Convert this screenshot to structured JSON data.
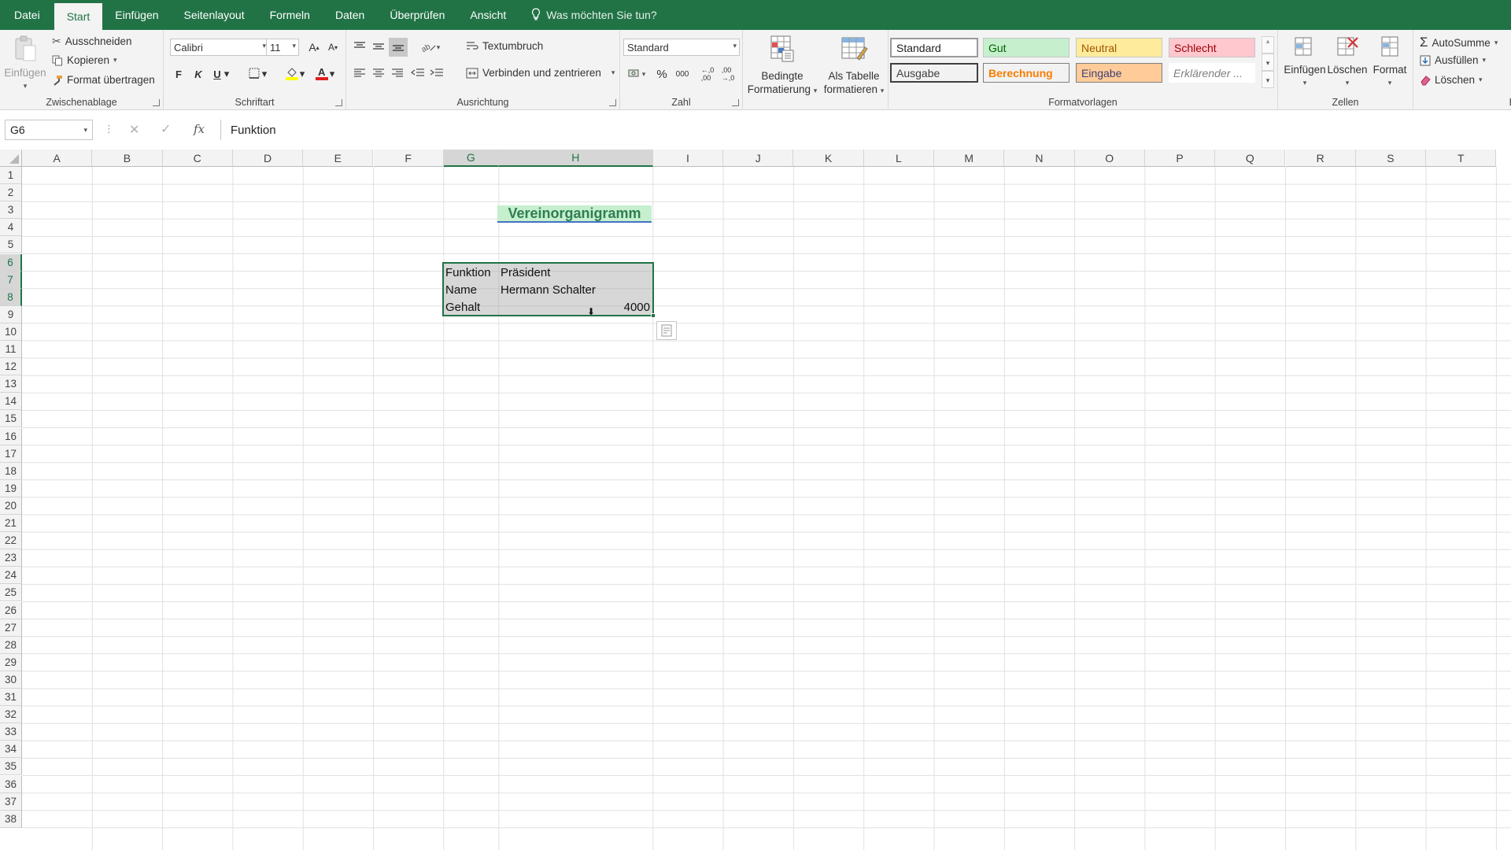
{
  "tabs": [
    {
      "label": "Datei",
      "active": false
    },
    {
      "label": "Start",
      "active": true
    },
    {
      "label": "Einfügen",
      "active": false
    },
    {
      "label": "Seitenlayout",
      "active": false
    },
    {
      "label": "Formeln",
      "active": false
    },
    {
      "label": "Daten",
      "active": false
    },
    {
      "label": "Überprüfen",
      "active": false
    },
    {
      "label": "Ansicht",
      "active": false
    }
  ],
  "tellme": {
    "label": "Was möchten Sie tun?",
    "icon": "lightbulb-icon"
  },
  "clipboard": {
    "group_label": "Zwischenablage",
    "paste_label": "Einfügen",
    "cut_label": "Ausschneiden",
    "copy_label": "Kopieren",
    "format_painter_label": "Format übertragen"
  },
  "font": {
    "group_label": "Schriftart",
    "family": "Calibri",
    "size": "11",
    "bold": "F",
    "italic": "K",
    "underline": "U"
  },
  "alignment": {
    "group_label": "Ausrichtung",
    "wrap_label": "Textumbruch",
    "merge_label": "Verbinden und zentrieren"
  },
  "number": {
    "group_label": "Zahl",
    "format": "Standard",
    "percent": "%",
    "thousands": "000"
  },
  "conditional": {
    "line1": "Bedingte",
    "line2": "Formatierung"
  },
  "as_table": {
    "line1": "Als Tabelle",
    "line2": "formatieren"
  },
  "styles": {
    "group_label": "Formatvorlagen",
    "items": [
      {
        "label": "Standard",
        "bg": "#ffffff",
        "color": "#000000"
      },
      {
        "label": "Gut",
        "bg": "#c6efce",
        "color": "#006100"
      },
      {
        "label": "Neutral",
        "bg": "#ffeb9c",
        "color": "#9c5700"
      },
      {
        "label": "Schlecht",
        "bg": "#ffc7ce",
        "color": "#9c0006"
      },
      {
        "label": "Ausgabe",
        "bg": "#f2f2f2",
        "color": "#3f3f3f"
      },
      {
        "label": "Berechnung",
        "bg": "#f2f2f2",
        "color": "#fa7d00"
      },
      {
        "label": "Eingabe",
        "bg": "#ffcc99",
        "color": "#3f3f76"
      },
      {
        "label": "Erklärender ...",
        "bg": "#ffffff",
        "color": "#7f7f7f"
      }
    ]
  },
  "cells_group": {
    "group_label": "Zellen",
    "insert_label": "Einfügen",
    "delete_label": "Löschen",
    "format_label": "Format"
  },
  "editing": {
    "autosum_label": "AutoSumme",
    "fill_label": "Ausfüllen",
    "clear_label": "Löschen",
    "group_label_partial": "B"
  },
  "formula_bar": {
    "name_box": "G6",
    "fx": "fx",
    "content": "Funktion"
  },
  "grid": {
    "columns": [
      "A",
      "B",
      "C",
      "D",
      "E",
      "F",
      "G",
      "H",
      "I",
      "J",
      "K",
      "L",
      "M",
      "N",
      "O",
      "P",
      "Q",
      "R",
      "S",
      "T"
    ],
    "selected_columns": [
      "G",
      "H"
    ],
    "rows": [
      1,
      2,
      3,
      4,
      5,
      6,
      7,
      8,
      9,
      10,
      11,
      12,
      13,
      14,
      15,
      16,
      17,
      18,
      19,
      20,
      21,
      22,
      23,
      24,
      25,
      26,
      27,
      28,
      29,
      30,
      31,
      32,
      33,
      34,
      35,
      36,
      37,
      38
    ],
    "selected_rows": [
      6,
      7,
      8
    ],
    "title": "Vereinorganigramm",
    "title_bg": "#c6efce",
    "title_color": "#2e7d55",
    "title_underline": "#4472c4",
    "table": [
      {
        "label": "Funktion",
        "value": "Präsident"
      },
      {
        "label": "Name",
        "value": "Hermann Schalter"
      },
      {
        "label": "Gehalt",
        "value": "4000"
      }
    ],
    "selection_color": "#217346"
  },
  "colors": {
    "accent": "#217346",
    "ribbon_bg": "#f3f3f3"
  }
}
